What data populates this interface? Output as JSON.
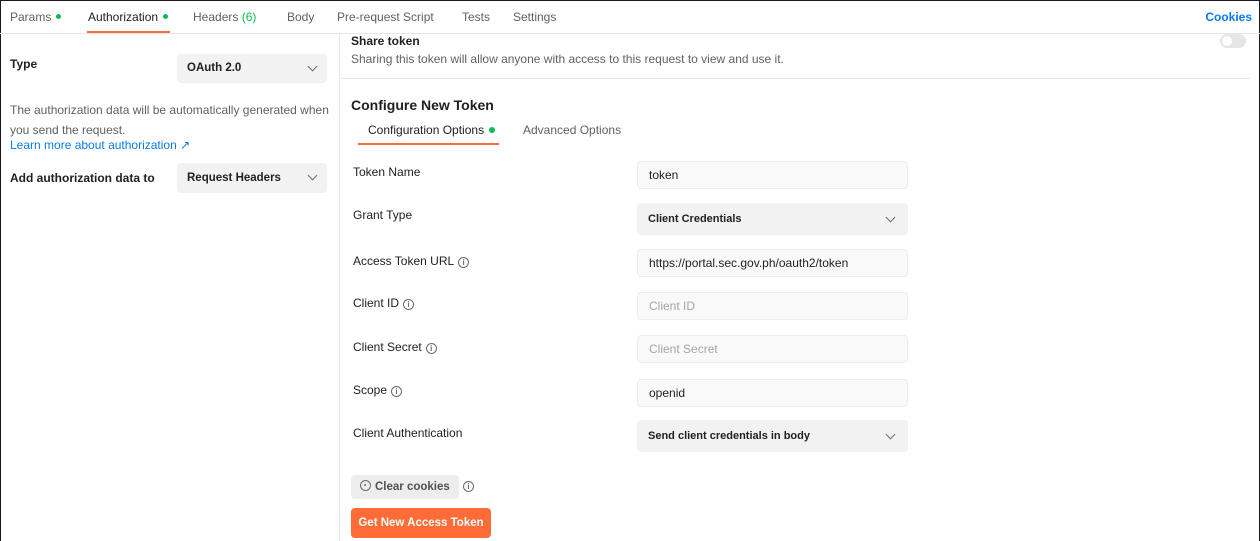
{
  "tabs": [
    {
      "label": "Params",
      "dot": true
    },
    {
      "label": "Authorization",
      "dot": true
    },
    {
      "label": "Headers",
      "count": "(6)"
    },
    {
      "label": "Body"
    },
    {
      "label": "Pre-request Script"
    },
    {
      "label": "Tests"
    },
    {
      "label": "Settings"
    }
  ],
  "cookies_link": "Cookies",
  "left": {
    "type_label": "Type",
    "type_value": "OAuth 2.0",
    "description": "The authorization data will be automatically generated when you send the request.",
    "learn_more": "Learn more about authorization ↗",
    "add_to_label": "Add authorization data to",
    "add_to_value": "Request Headers"
  },
  "share": {
    "title": "Share token",
    "description": "Sharing this token will allow anyone with access to this request to view and use it.",
    "enabled": false
  },
  "configure": {
    "title": "Configure New Token",
    "subtabs": [
      {
        "label": "Configuration Options",
        "dot": true
      },
      {
        "label": "Advanced Options"
      }
    ],
    "fields": {
      "token_name": {
        "label": "Token Name",
        "value": "token"
      },
      "grant_type": {
        "label": "Grant Type",
        "value": "Client Credentials"
      },
      "access_token_url": {
        "label": "Access Token URL",
        "value": "https://portal.sec.gov.ph/oauth2/token"
      },
      "client_id": {
        "label": "Client ID",
        "placeholder": "Client ID"
      },
      "client_secret": {
        "label": "Client Secret",
        "placeholder": "Client Secret"
      },
      "scope": {
        "label": "Scope",
        "value": "openid"
      },
      "client_auth": {
        "label": "Client Authentication",
        "value": "Send client credentials in body"
      }
    },
    "clear_cookies": "Clear cookies",
    "get_token": "Get New Access Token"
  },
  "colors": {
    "accent": "#ff6c37",
    "link": "#097bed",
    "status_green": "#0cbb52"
  }
}
